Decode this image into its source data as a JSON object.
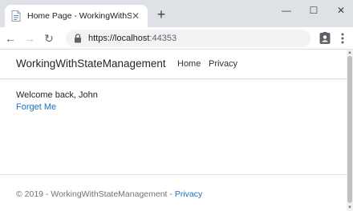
{
  "browser": {
    "tab_title": "Home Page - WorkingWithStateManagement",
    "tab_close_glyph": "✕",
    "new_tab_glyph": "+",
    "window_minimize_glyph": "—",
    "window_maximize_glyph": "☐",
    "window_close_glyph": "✕",
    "back_glyph": "←",
    "forward_glyph": "→",
    "reload_glyph": "↻",
    "url_scheme_host": "https://localhost",
    "url_port": ":44353",
    "icons": [
      "page-favicon-icon",
      "lock-icon",
      "profile-icon",
      "kebab-menu-icon"
    ]
  },
  "navbar": {
    "brand": "WorkingWithStateManagement",
    "links": [
      {
        "label": "Home"
      },
      {
        "label": "Privacy"
      }
    ]
  },
  "main": {
    "welcome": "Welcome back, John",
    "forget_link": "Forget Me"
  },
  "footer": {
    "copyright": "© 2019 - WorkingWithStateManagement - ",
    "privacy_link": "Privacy"
  },
  "colors": {
    "link": "#1b6ec2",
    "tabstrip": "#dee1e6",
    "omnibox": "#f1f3f4"
  }
}
